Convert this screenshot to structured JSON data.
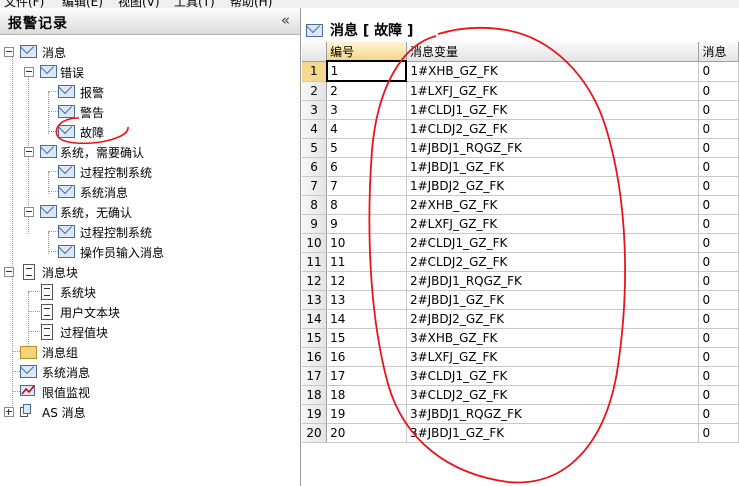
{
  "menu": [
    "文件(F)",
    "编辑(E)",
    "视图(V)",
    "工具(T)",
    "帮助(H)"
  ],
  "left_panel": {
    "title": "报警记录",
    "collapse_glyph": "«",
    "tree": [
      {
        "label": "消息",
        "icon": "envelope-icon",
        "expanded": true
      },
      {
        "label": "错误",
        "icon": "envelope-icon",
        "expanded": true
      },
      {
        "label": "报警",
        "icon": "envelope-icon"
      },
      {
        "label": "警告",
        "icon": "envelope-icon"
      },
      {
        "label": "故障",
        "icon": "envelope-icon"
      },
      {
        "label": "系统，需要确认",
        "icon": "envelope-icon",
        "expanded": true
      },
      {
        "label": "过程控制系统",
        "icon": "envelope-icon"
      },
      {
        "label": "系统消息",
        "icon": "envelope-icon"
      },
      {
        "label": "系统，无确认",
        "icon": "envelope-icon",
        "expanded": true
      },
      {
        "label": "过程控制系统",
        "icon": "envelope-icon"
      },
      {
        "label": "操作员输入消息",
        "icon": "envelope-icon"
      },
      {
        "label": "消息块",
        "icon": "document-icon",
        "expanded": true
      },
      {
        "label": "系统块",
        "icon": "document-icon"
      },
      {
        "label": "用户文本块",
        "icon": "document-icon"
      },
      {
        "label": "过程值块",
        "icon": "document-icon"
      },
      {
        "label": "消息组",
        "icon": "folder-icon"
      },
      {
        "label": "系统消息",
        "icon": "envelope-icon"
      },
      {
        "label": "限值监视",
        "icon": "limit-icon"
      },
      {
        "label": "AS 消息",
        "icon": "as-message-icon",
        "expanded": false
      }
    ]
  },
  "right_panel": {
    "title": "消息  [  故障  ]",
    "columns": [
      "编号",
      "消息变量",
      "消息"
    ],
    "rows": [
      [
        "1",
        "1",
        "1#XHB_GZ_FK",
        "0"
      ],
      [
        "2",
        "2",
        "1#LXFJ_GZ_FK",
        "0"
      ],
      [
        "3",
        "3",
        "1#CLDJ1_GZ_FK",
        "0"
      ],
      [
        "4",
        "4",
        "1#CLDJ2_GZ_FK",
        "0"
      ],
      [
        "5",
        "5",
        "1#JBDJ1_RQGZ_FK",
        "0"
      ],
      [
        "6",
        "6",
        "1#JBDJ1_GZ_FK",
        "0"
      ],
      [
        "7",
        "7",
        "1#JBDJ2_GZ_FK",
        "0"
      ],
      [
        "8",
        "8",
        "2#XHB_GZ_FK",
        "0"
      ],
      [
        "9",
        "9",
        "2#LXFJ_GZ_FK",
        "0"
      ],
      [
        "10",
        "10",
        "2#CLDJ1_GZ_FK",
        "0"
      ],
      [
        "11",
        "11",
        "2#CLDJ2_GZ_FK",
        "0"
      ],
      [
        "12",
        "12",
        "2#JBDJ1_RQGZ_FK",
        "0"
      ],
      [
        "13",
        "13",
        "2#JBDJ1_GZ_FK",
        "0"
      ],
      [
        "14",
        "14",
        "2#JBDJ2_GZ_FK",
        "0"
      ],
      [
        "15",
        "15",
        "3#XHB_GZ_FK",
        "0"
      ],
      [
        "16",
        "16",
        "3#LXFJ_GZ_FK",
        "0"
      ],
      [
        "17",
        "17",
        "3#CLDJ1_GZ_FK",
        "0"
      ],
      [
        "18",
        "18",
        "3#CLDJ2_GZ_FK",
        "0"
      ],
      [
        "19",
        "19",
        "3#JBDJ1_RQGZ_FK",
        "0"
      ],
      [
        "20",
        "20",
        "3#JBDJ1_GZ_FK",
        "0"
      ]
    ]
  },
  "colors": {
    "annotation": "#e8141c",
    "selected_header": "#f4d48a"
  }
}
